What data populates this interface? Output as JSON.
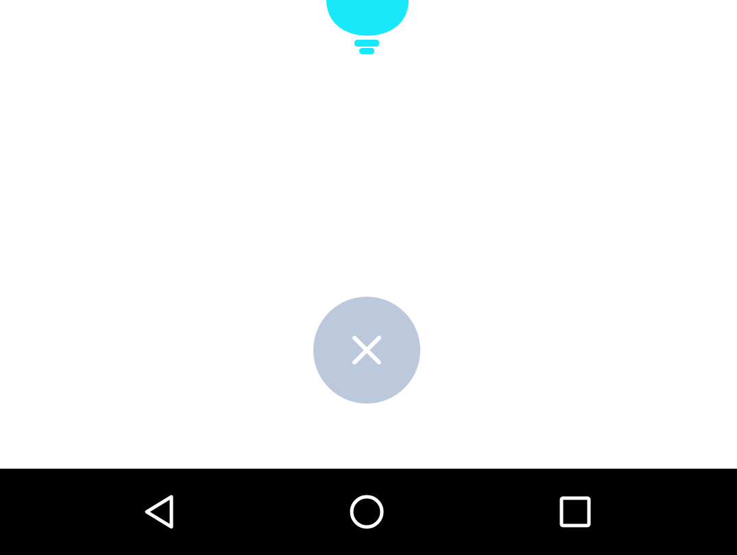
{
  "colors": {
    "background": "#ffffff",
    "bulb": "#19e8fb",
    "close_button": "#bcc8dc",
    "close_icon": "#ffffff",
    "navbar": "#000000",
    "nav_icon": "#ffffff"
  },
  "icons": {
    "bulb": "lightbulb-icon",
    "close": "close-icon",
    "back": "back-triangle-icon",
    "home": "home-circle-icon",
    "recents": "recents-square-icon"
  }
}
